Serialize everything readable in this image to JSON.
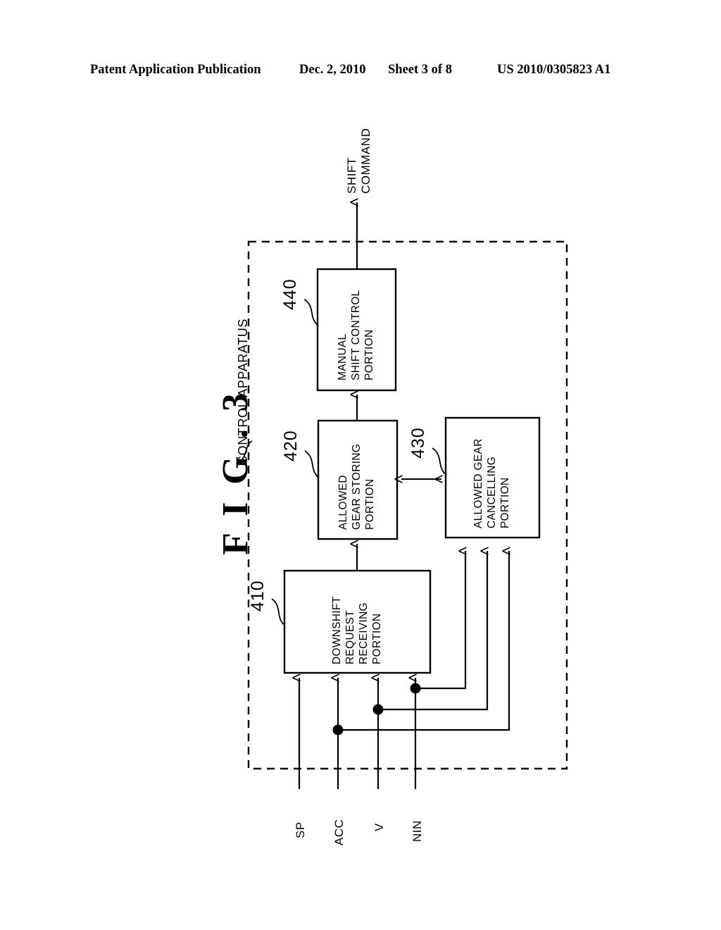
{
  "header": {
    "publication": "Patent Application Publication",
    "date": "Dec. 2, 2010",
    "sheet": "Sheet 3 of 8",
    "patent_number": "US 2010/0305823 A1"
  },
  "figure": {
    "title": "F I G . 3",
    "enclosure_label": "CONTROL APPARATUS",
    "output_label_line1": "SHIFT",
    "output_label_line2": "COMMAND",
    "blocks": [
      {
        "ref": "410",
        "lines": [
          "DOWNSHIFT",
          "REQUEST",
          "RECEIVING",
          "PORTION"
        ]
      },
      {
        "ref": "420",
        "lines": [
          "ALLOWED",
          "GEAR STORING",
          "PORTION"
        ]
      },
      {
        "ref": "430",
        "lines": [
          "ALLOWED GEAR",
          "CANCELLING",
          "PORTION"
        ]
      },
      {
        "ref": "440",
        "lines": [
          "MANUAL",
          "SHIFT CONTROL",
          "PORTION"
        ]
      }
    ],
    "inputs": [
      {
        "label": "SP"
      },
      {
        "label": "ACC"
      },
      {
        "label": "V"
      },
      {
        "label": "NIN"
      }
    ]
  },
  "colors": {
    "ink": "#000000",
    "paper": "#ffffff"
  }
}
